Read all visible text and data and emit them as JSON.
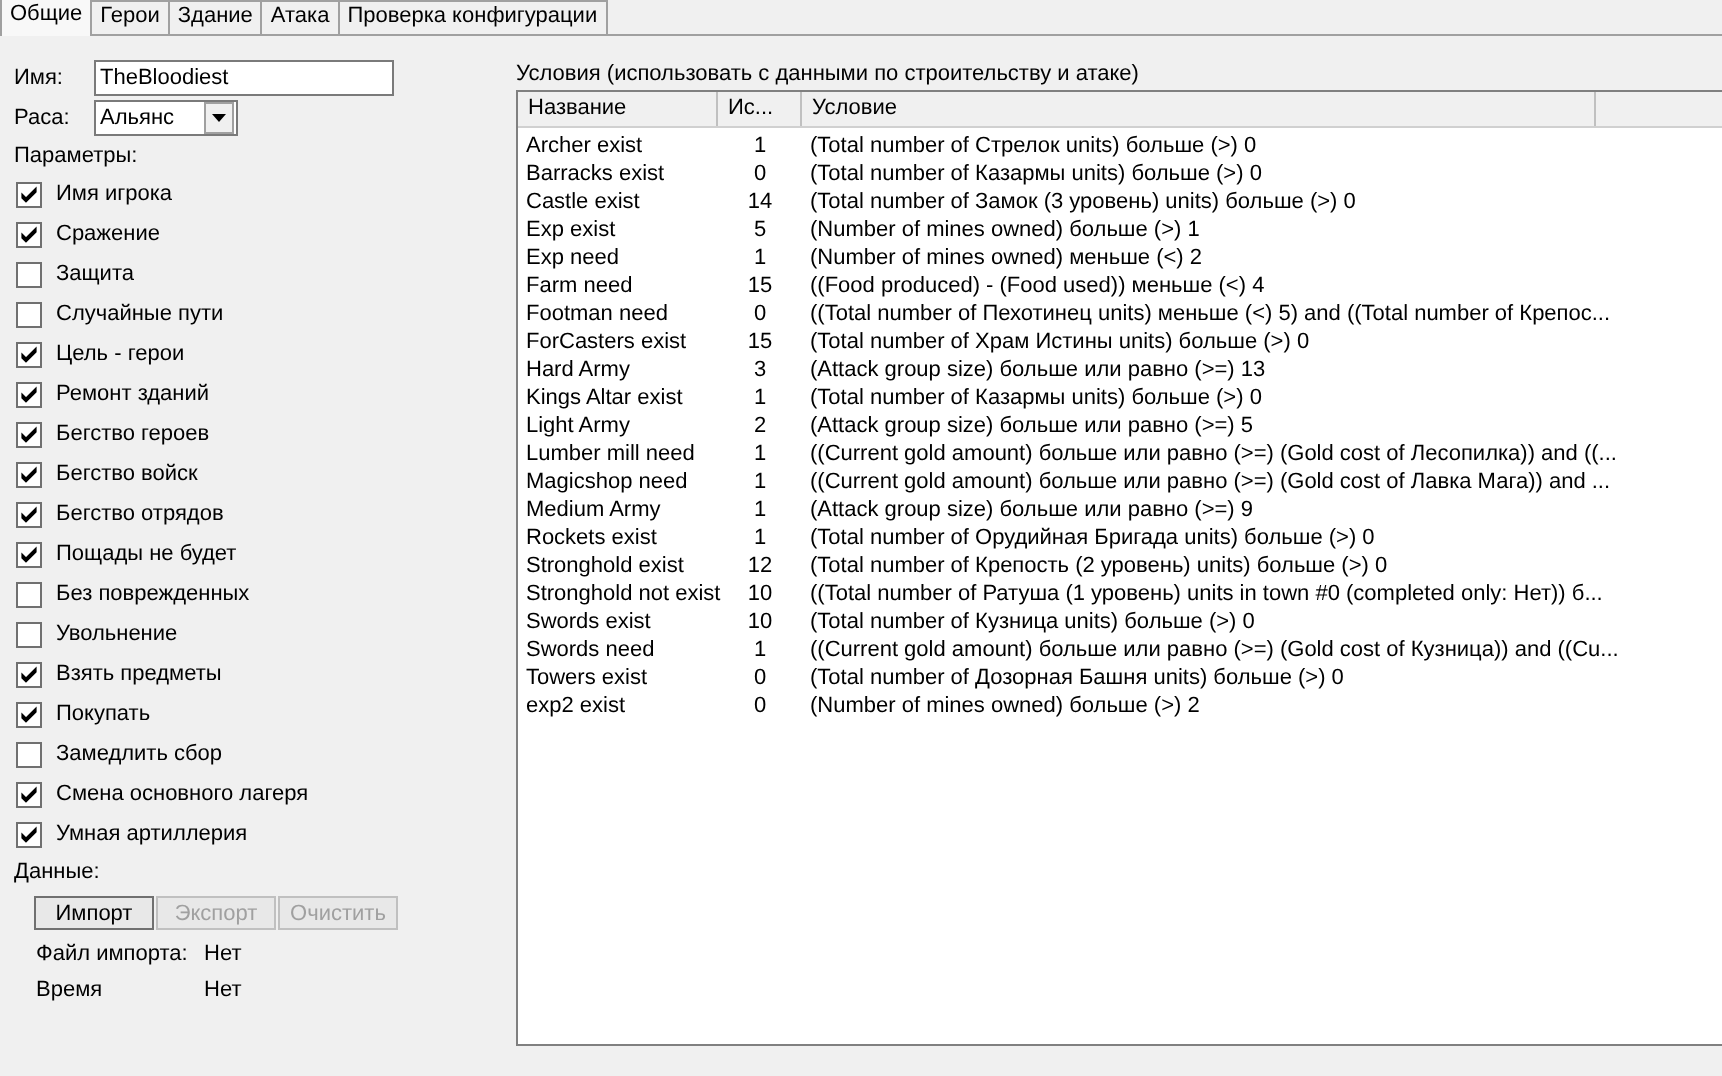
{
  "tabs": [
    {
      "label": "Общие",
      "selected": true
    },
    {
      "label": "Герои",
      "selected": false
    },
    {
      "label": "Здание",
      "selected": false
    },
    {
      "label": "Атака",
      "selected": false
    },
    {
      "label": "Проверка конфигурации",
      "selected": false
    }
  ],
  "name_field": {
    "label": "Имя:",
    "value": "TheBloodiest"
  },
  "race_field": {
    "label": "Раса:",
    "value": "Альянс"
  },
  "parameters_label": "Параметры:",
  "parameters": [
    {
      "label": "Имя игрока",
      "checked": true
    },
    {
      "label": "Сражение",
      "checked": true
    },
    {
      "label": "Защита",
      "checked": false
    },
    {
      "label": "Случайные пути",
      "checked": false
    },
    {
      "label": "Цель - герои",
      "checked": true
    },
    {
      "label": "Ремонт зданий",
      "checked": true
    },
    {
      "label": "Бегство героев",
      "checked": true
    },
    {
      "label": "Бегство войск",
      "checked": true
    },
    {
      "label": "Бегство отрядов",
      "checked": true
    },
    {
      "label": "Пощады не будет",
      "checked": true
    },
    {
      "label": "Без поврежденных",
      "checked": false
    },
    {
      "label": "Увольнение",
      "checked": false
    },
    {
      "label": "Взять предметы",
      "checked": true
    },
    {
      "label": "Покупать",
      "checked": true
    },
    {
      "label": "Замедлить сбор",
      "checked": false
    },
    {
      "label": "Смена основного лагеря",
      "checked": true
    },
    {
      "label": "Умная артиллерия",
      "checked": true
    }
  ],
  "data_label": "Данные:",
  "data_buttons": [
    {
      "label": "Импорт",
      "disabled": false
    },
    {
      "label": "Экспорт",
      "disabled": true
    },
    {
      "label": "Очистить",
      "disabled": true
    }
  ],
  "info": [
    {
      "label": "Файл импорта:",
      "value": "Нет"
    },
    {
      "label": "Время",
      "value": "Нет"
    }
  ],
  "conditions": {
    "title": "Условия (использовать с данными по строительству и атаке)",
    "columns": [
      "Название",
      "Ис...",
      "Условие"
    ],
    "rows": [
      [
        "Archer exist",
        "1",
        "(Total number of Стрелок units) больше (>) 0"
      ],
      [
        "Barracks exist",
        "0",
        "(Total number of Казармы units) больше (>) 0"
      ],
      [
        "Castle exist",
        "14",
        "(Total number of Замок (3 уровень) units) больше (>) 0"
      ],
      [
        "Exp exist",
        "5",
        "(Number of mines owned) больше (>) 1"
      ],
      [
        "Exp need",
        "1",
        "(Number of mines owned) меньше (<) 2"
      ],
      [
        "Farm need",
        "15",
        "((Food produced) - (Food used)) меньше (<) 4"
      ],
      [
        "Footman need",
        "0",
        "((Total number of Пехотинец units) меньше (<) 5) and ((Total number of Крепос..."
      ],
      [
        "ForCasters exist",
        "15",
        "(Total number of Храм Истины units) больше (>) 0"
      ],
      [
        "Hard Army",
        "3",
        "(Attack group size) больше или равно (>=) 13"
      ],
      [
        "Kings Altar exist",
        "1",
        "(Total number of Казармы units) больше (>) 0"
      ],
      [
        "Light Army",
        "2",
        "(Attack group size) больше или равно (>=) 5"
      ],
      [
        "Lumber mill need",
        "1",
        "((Current gold amount) больше или равно (>=) (Gold cost of Лесопилка)) and ((..."
      ],
      [
        "Magicshop need",
        "1",
        "((Current gold amount) больше или равно (>=) (Gold cost of Лавка Мага)) and ..."
      ],
      [
        "Medium Army",
        "1",
        "(Attack group size) больше или равно (>=) 9"
      ],
      [
        "Rockets exist",
        "1",
        "(Total number of Орудийная Бригада units) больше (>) 0"
      ],
      [
        "Stronghold exist",
        "12",
        "(Total number of Крепость (2 уровень) units) больше (>) 0"
      ],
      [
        "Stronghold not exist",
        "10",
        "((Total number of Ратуша (1 уровень) units in town #0 (completed only: Нет)) б..."
      ],
      [
        "Swords exist",
        "10",
        "(Total number of Кузница units) больше (>) 0"
      ],
      [
        "Swords need",
        "1",
        "((Current gold amount) больше или равно (>=) (Gold cost of Кузница)) and ((Cu..."
      ],
      [
        "Towers exist",
        "0",
        "(Total number of Дозорная Башня units) больше (>) 0"
      ],
      [
        "exp2 exist",
        "0",
        "(Number of mines owned) больше (>) 2"
      ]
    ]
  }
}
